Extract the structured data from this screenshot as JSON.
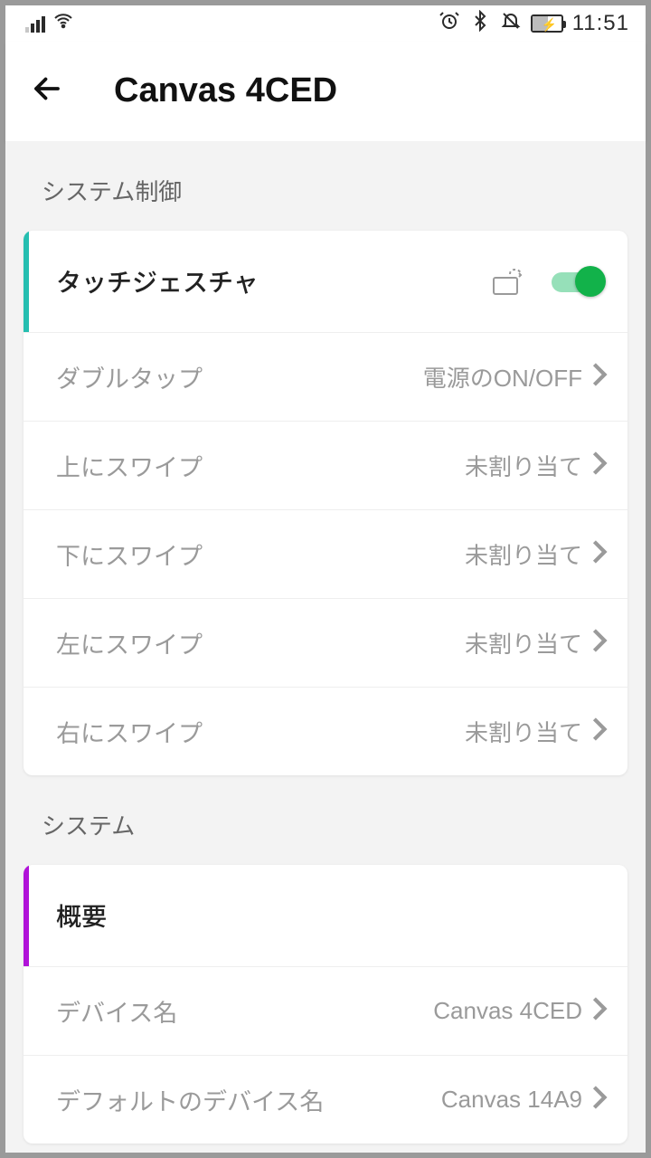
{
  "status": {
    "time": "11:51"
  },
  "header": {
    "title": "Canvas 4CED"
  },
  "sections": {
    "system_control": {
      "label": "システム制御",
      "touch_gesture": {
        "label": "タッチジェスチャ",
        "enabled": true
      },
      "rows": [
        {
          "label": "ダブルタップ",
          "value": "電源のON/OFF"
        },
        {
          "label": "上にスワイプ",
          "value": "未割り当て"
        },
        {
          "label": "下にスワイプ",
          "value": "未割り当て"
        },
        {
          "label": "左にスワイプ",
          "value": "未割り当て"
        },
        {
          "label": "右にスワイプ",
          "value": "未割り当て"
        }
      ]
    },
    "system": {
      "label": "システム",
      "overview": {
        "label": "概要"
      },
      "rows": [
        {
          "label": "デバイス名",
          "value": "Canvas 4CED"
        },
        {
          "label": "デフォルトのデバイス名",
          "value": "Canvas 14A9"
        }
      ]
    }
  }
}
